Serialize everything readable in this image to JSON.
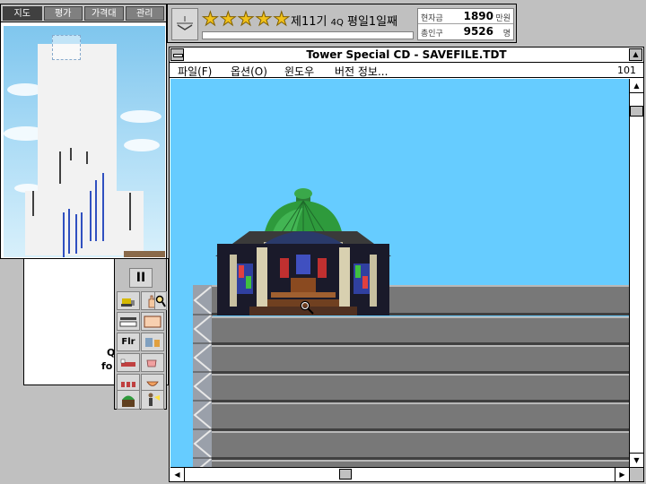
{
  "map_window": {
    "tabs": [
      {
        "label": "지도"
      },
      {
        "label": "평가"
      },
      {
        "label": "가격대"
      },
      {
        "label": "관리"
      }
    ],
    "active_tab": "지도"
  },
  "status": {
    "rating_stars": 5,
    "period_prefix": "제11기",
    "period_quarter": "4Q",
    "period_day": "평일1일째",
    "funds": {
      "label": "현자금",
      "value": "1890",
      "unit": "만원"
    },
    "population": {
      "label": "총인구",
      "value": "9526",
      "unit": "명"
    }
  },
  "behind_window": {
    "text_line1": "Q",
    "text_line2": "fo"
  },
  "tools": {
    "pause_label": "II",
    "floor_label": "Flr"
  },
  "main_window": {
    "title": "Tower Special CD - SAVEFILE.TDT",
    "menu": [
      {
        "label": "파일(F)"
      },
      {
        "label": "옵션(O)"
      },
      {
        "label": "윈도우"
      },
      {
        "label": "버전 정보..."
      }
    ],
    "floor_number": "101"
  },
  "icons": {
    "star": "★",
    "scroll_up": "▲",
    "scroll_down": "▼",
    "scroll_left": "◀",
    "scroll_right": "▶"
  },
  "colors": {
    "sky": "#66ccff",
    "floor": "#787878",
    "star": "#f2c21a",
    "dome": "#2e9a3c"
  }
}
